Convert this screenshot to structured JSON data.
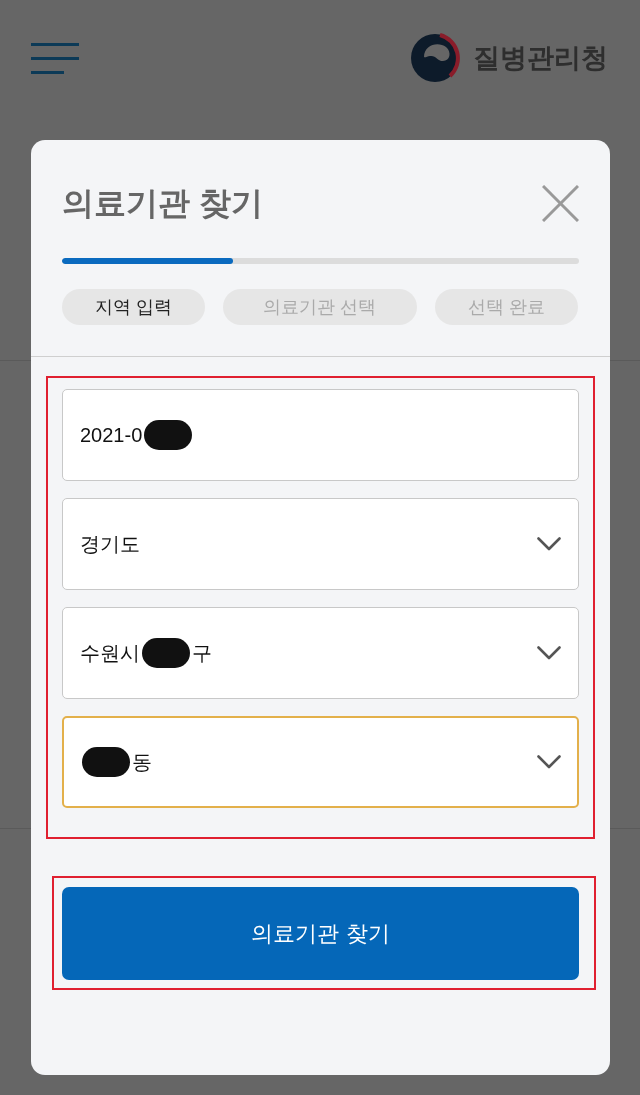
{
  "header": {
    "agency_name": "질병관리청"
  },
  "dialog": {
    "title": "의료기관 찾기",
    "progress": {
      "level": 0.33
    },
    "steps": [
      {
        "label": "지역 입력",
        "selected": true
      },
      {
        "label": "의료기관 선택",
        "selected": false
      },
      {
        "label": "선택 완료",
        "selected": false
      }
    ],
    "form": {
      "highlighted": true,
      "fields": [
        {
          "kind": "date",
          "focused": false,
          "segments": [
            {
              "kind": "text",
              "text": "2021-0"
            },
            {
              "kind": "redaction"
            }
          ]
        },
        {
          "kind": "select",
          "focused": false,
          "segments": [
            {
              "kind": "text",
              "text": "경기도"
            }
          ]
        },
        {
          "kind": "select",
          "focused": false,
          "segments": [
            {
              "kind": "text",
              "text": "수원시"
            },
            {
              "kind": "redaction"
            },
            {
              "kind": "text",
              "text": "구"
            }
          ]
        },
        {
          "kind": "select",
          "focused": true,
          "segments": [
            {
              "kind": "redaction"
            },
            {
              "kind": "text",
              "text": "동"
            }
          ]
        }
      ]
    },
    "submit": {
      "label": "의료기관 찾기",
      "highlighted": true
    }
  }
}
